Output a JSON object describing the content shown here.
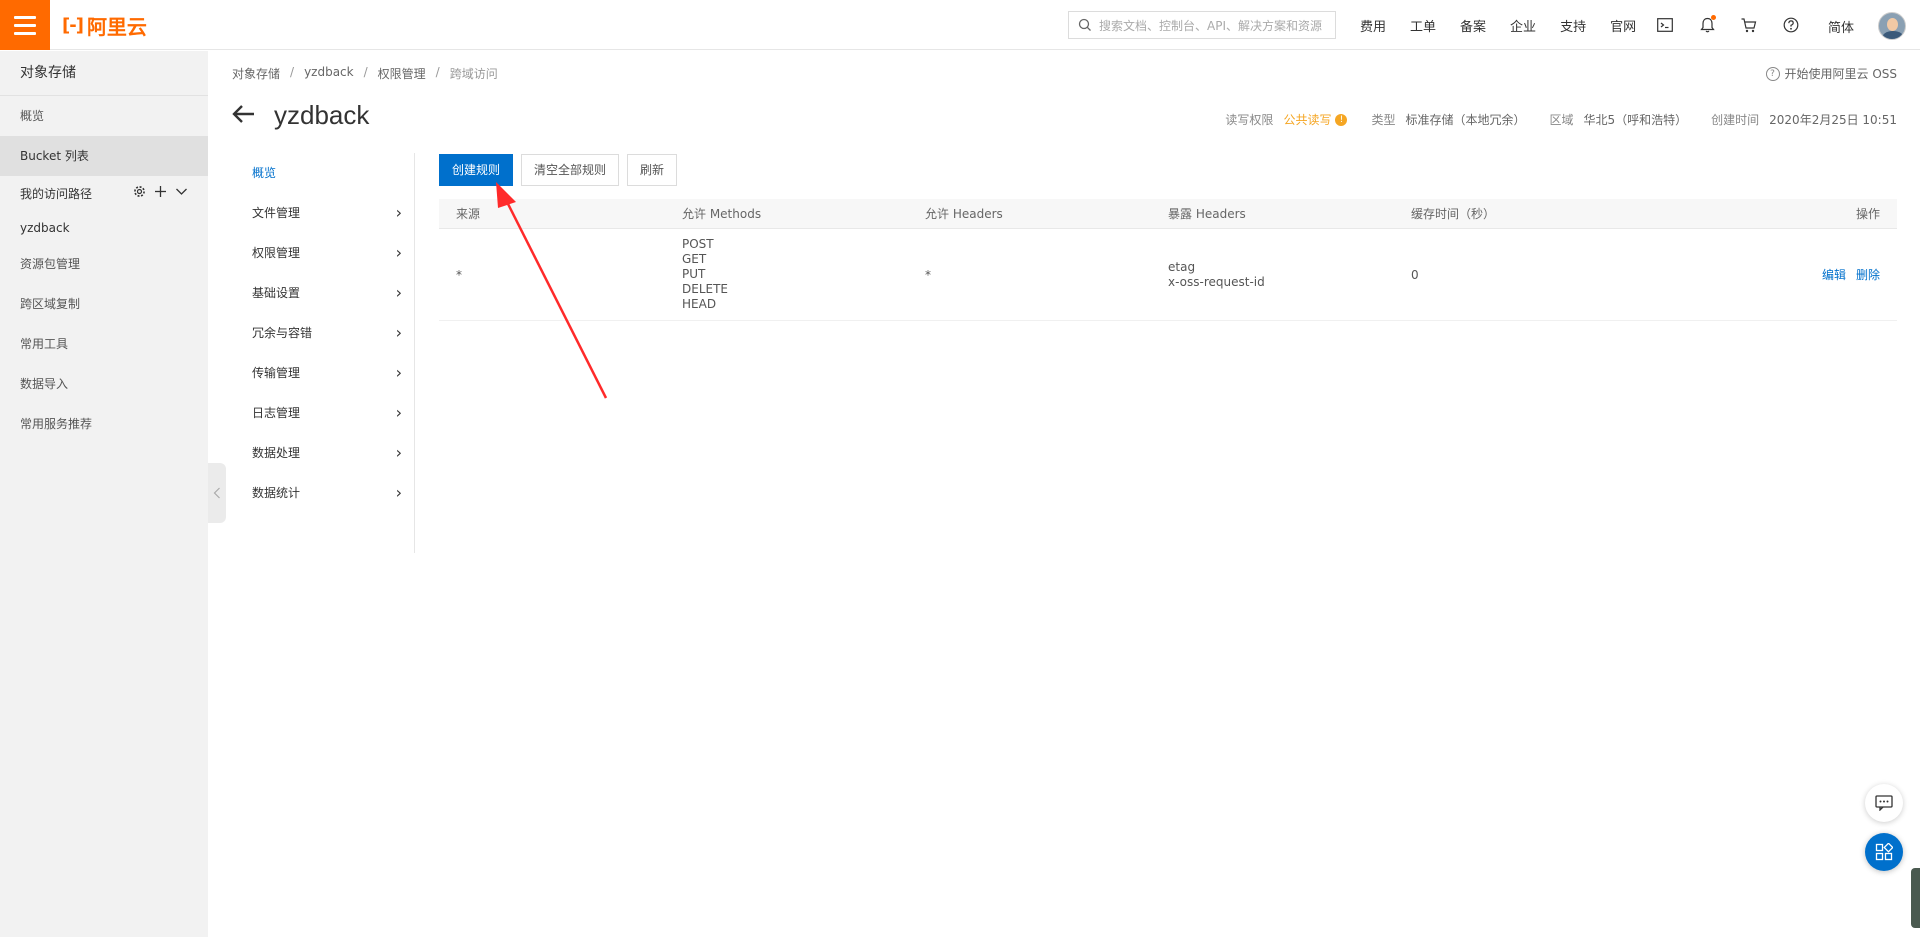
{
  "topbar": {
    "logo_text": "阿里云",
    "search_placeholder": "搜索文档、控制台、API、解决方案和资源",
    "nav": [
      "费用",
      "工单",
      "备案",
      "企业",
      "支持",
      "官网"
    ],
    "lang": "简体"
  },
  "sidebar": {
    "title": "对象存储",
    "overview": "概览",
    "bucket_list": "Bucket 列表",
    "my_paths": "我的访问路径",
    "path_bucket": "yzdback",
    "items": [
      "资源包管理",
      "跨区域复制",
      "常用工具",
      "数据导入",
      "常用服务推荐"
    ]
  },
  "breadcrumb": [
    "对象存储",
    "yzdback",
    "权限管理",
    "跨域访问"
  ],
  "help_link": "开始使用阿里云 OSS",
  "bucket": {
    "name": "yzdback",
    "acl_label": "读写权限",
    "acl_value": "公共读写",
    "type_label": "类型",
    "type_value": "标准存储（本地冗余）",
    "region_label": "区域",
    "region_value": "华北5（呼和浩特）",
    "created_label": "创建时间",
    "created_value": "2020年2月25日 10:51"
  },
  "subnav": [
    "概览",
    "文件管理",
    "权限管理",
    "基础设置",
    "冗余与容错",
    "传输管理",
    "日志管理",
    "数据处理",
    "数据统计"
  ],
  "actions": {
    "create": "创建规则",
    "clear": "清空全部规则",
    "refresh": "刷新"
  },
  "table": {
    "headers": [
      "来源",
      "允许 Methods",
      "允许 Headers",
      "暴露 Headers",
      "缓存时间（秒）",
      "操作"
    ],
    "rows": [
      {
        "origin": "*",
        "methods": [
          "POST",
          "GET",
          "PUT",
          "DELETE",
          "HEAD"
        ],
        "allow_headers": "*",
        "expose_headers": [
          "etag",
          "x-oss-request-id"
        ],
        "max_age": "0",
        "edit": "编辑",
        "delete": "删除"
      }
    ]
  },
  "colors": {
    "brand": "#ff6a00",
    "primary": "#0070cc",
    "warning": "#f5a623",
    "annotation_arrow": "#ff2a2a"
  }
}
